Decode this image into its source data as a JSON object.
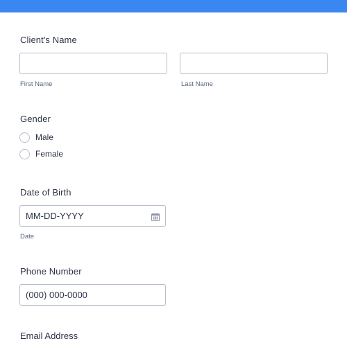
{
  "form": {
    "client_name": {
      "label": "Client's Name",
      "first_sublabel": "First Name",
      "last_sublabel": "Last Name",
      "first_value": "",
      "last_value": ""
    },
    "gender": {
      "label": "Gender",
      "options": [
        "Male",
        "Female"
      ]
    },
    "dob": {
      "label": "Date of Birth",
      "placeholder": "MM-DD-YYYY",
      "sublabel": "Date",
      "icon": "calendar-icon"
    },
    "phone": {
      "label": "Phone Number",
      "placeholder": "(000) 000-0000"
    },
    "email": {
      "label": "Email Address"
    }
  },
  "colors": {
    "header_bar": "#3b87f2",
    "text": "#2c3345",
    "sublabel": "#57647e",
    "border": "#b8bdc9"
  }
}
